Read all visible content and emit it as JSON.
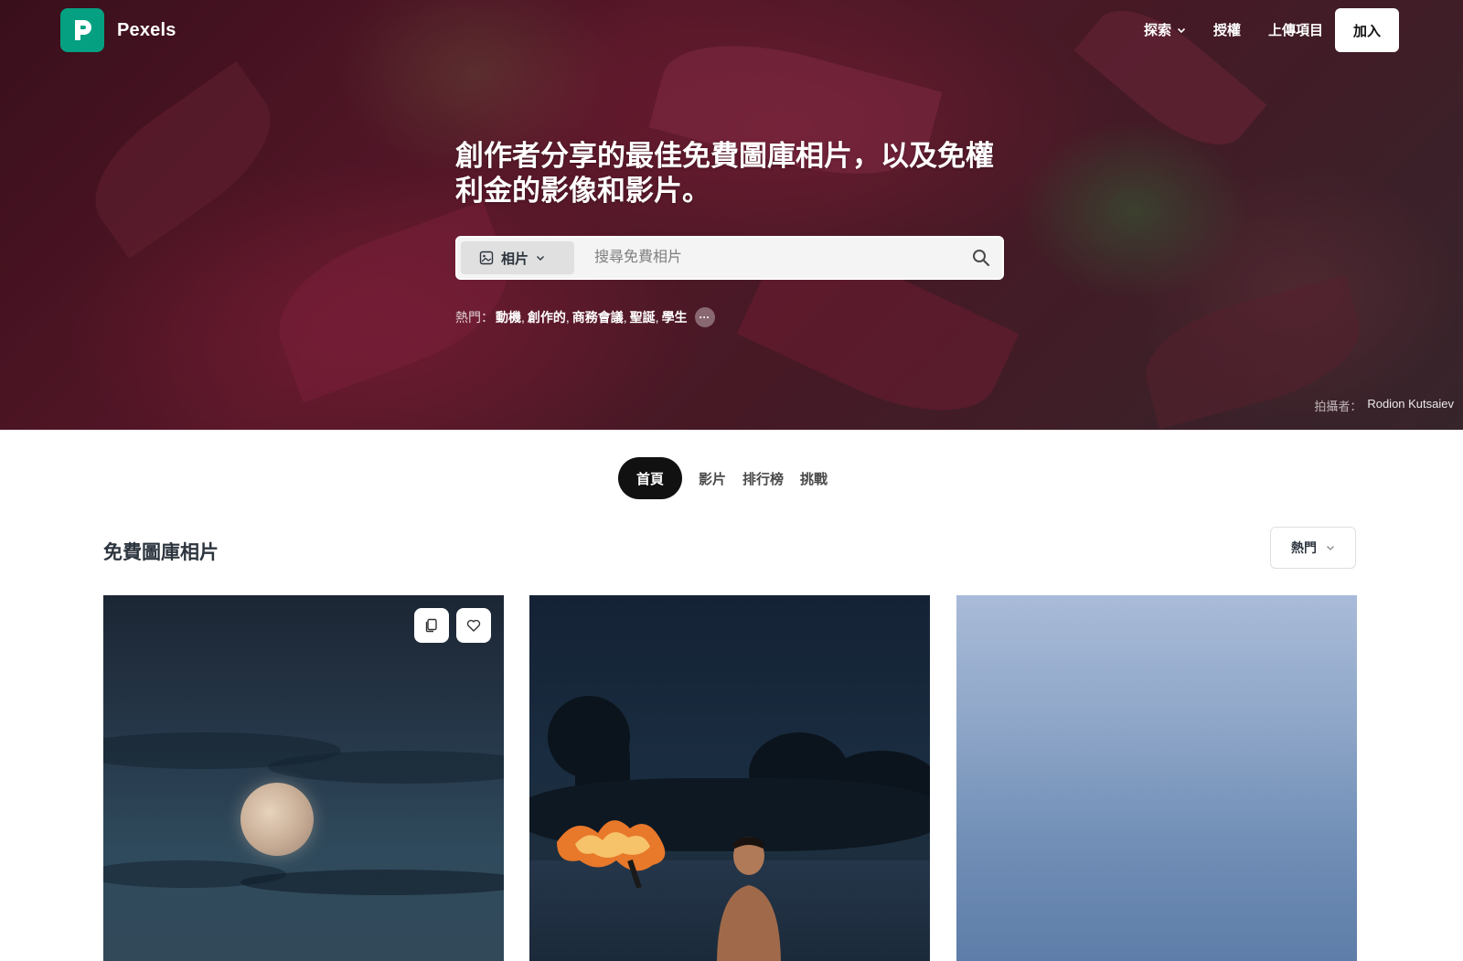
{
  "brand": {
    "name": "Pexels",
    "logo_letter": "P",
    "accent": "#05a081"
  },
  "nav": {
    "explore": "探索",
    "license": "授權",
    "upload": "上傳項目",
    "more": "···",
    "join": "加入"
  },
  "hero": {
    "headline": "創作者分享的最佳免費圖庫相片，以及免權利金的影像和影片。",
    "search": {
      "type_label": "相片",
      "placeholder": "搜尋免費相片"
    },
    "trending": {
      "label": "熱門：",
      "items": [
        "動機",
        "創作的",
        "商務會議",
        "聖誕",
        "學生"
      ],
      "more": "···"
    },
    "credit": {
      "label": "拍攝者：",
      "name": "Rodion Kutsaiev"
    }
  },
  "tabs": [
    {
      "label": "首頁",
      "active": true
    },
    {
      "label": "影片",
      "active": false
    },
    {
      "label": "排行榜",
      "active": false
    },
    {
      "label": "挑戰",
      "active": false
    }
  ],
  "section": {
    "title": "免費圖庫相片",
    "sort": "熱門"
  },
  "photos": [
    {
      "subject": "full-moon-night-sky"
    },
    {
      "subject": "man-with-torch-at-night"
    },
    {
      "subject": "blue-sky-gradient"
    }
  ]
}
